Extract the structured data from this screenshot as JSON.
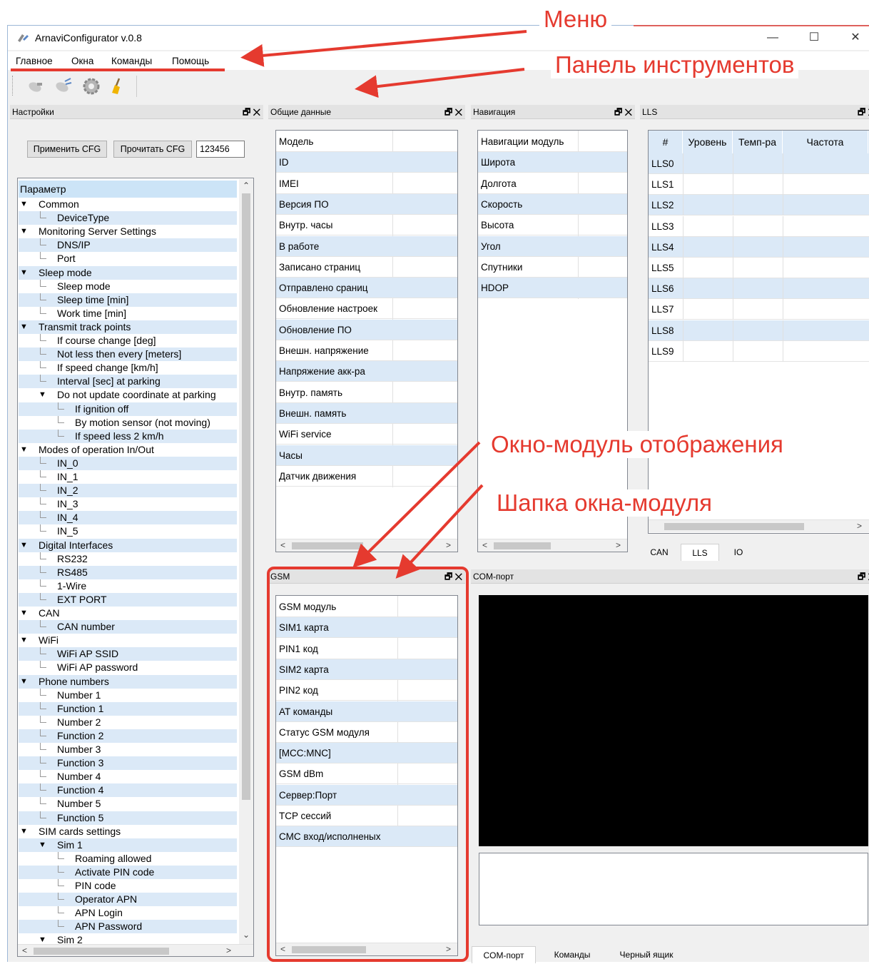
{
  "window": {
    "title": "ArnaviConfigurator v.0.8",
    "minimize": "—",
    "maximize": "☐",
    "close": "✕"
  },
  "menu": [
    "Главное",
    "Окна",
    "Команды",
    "Помощь"
  ],
  "toolbar": {
    "icons": [
      "connect-icon",
      "disconnect-icon",
      "settings-gear-icon",
      "clear-broom-icon"
    ]
  },
  "settings_panel": {
    "title": "Настройки",
    "ctrl": "🗗 ✕",
    "apply_btn": "Применить CFG",
    "read_btn": "Прочитать CFG",
    "password": "123456",
    "tree_header": "Параметр",
    "tree": [
      {
        "l": 0,
        "t": "Common",
        "e": true
      },
      {
        "l": 1,
        "t": "DeviceType"
      },
      {
        "l": 0,
        "t": "Monitoring Server Settings",
        "e": true
      },
      {
        "l": 1,
        "t": "DNS/IP"
      },
      {
        "l": 1,
        "t": "Port"
      },
      {
        "l": 0,
        "t": "Sleep mode",
        "e": true
      },
      {
        "l": 1,
        "t": "Sleep mode"
      },
      {
        "l": 1,
        "t": "Sleep time [min]"
      },
      {
        "l": 1,
        "t": "Work time [min]"
      },
      {
        "l": 0,
        "t": "Transmit track points",
        "e": true
      },
      {
        "l": 1,
        "t": "If course change [deg]"
      },
      {
        "l": 1,
        "t": "Not less then every [meters]"
      },
      {
        "l": 1,
        "t": "If speed change [km/h]"
      },
      {
        "l": 1,
        "t": "Interval [sec] at parking"
      },
      {
        "l": 1,
        "t": "Do not update coordinate at parking",
        "e": true
      },
      {
        "l": 2,
        "t": "If ignition off"
      },
      {
        "l": 2,
        "t": "By motion sensor (not moving)"
      },
      {
        "l": 2,
        "t": "If speed less 2 km/h"
      },
      {
        "l": 0,
        "t": "Modes of operation In/Out",
        "e": true
      },
      {
        "l": 1,
        "t": "IN_0"
      },
      {
        "l": 1,
        "t": "IN_1"
      },
      {
        "l": 1,
        "t": "IN_2"
      },
      {
        "l": 1,
        "t": "IN_3"
      },
      {
        "l": 1,
        "t": "IN_4"
      },
      {
        "l": 1,
        "t": "IN_5"
      },
      {
        "l": 0,
        "t": "Digital Interfaces",
        "e": true
      },
      {
        "l": 1,
        "t": "RS232"
      },
      {
        "l": 1,
        "t": "RS485"
      },
      {
        "l": 1,
        "t": "1-Wire"
      },
      {
        "l": 1,
        "t": "EXT PORT"
      },
      {
        "l": 0,
        "t": "CAN",
        "e": true
      },
      {
        "l": 1,
        "t": "CAN number"
      },
      {
        "l": 0,
        "t": "WiFi",
        "e": true
      },
      {
        "l": 1,
        "t": "WiFi AP SSID"
      },
      {
        "l": 1,
        "t": "WiFi AP password"
      },
      {
        "l": 0,
        "t": "Phone numbers",
        "e": true
      },
      {
        "l": 1,
        "t": "Number 1"
      },
      {
        "l": 1,
        "t": "Function 1"
      },
      {
        "l": 1,
        "t": "Number 2"
      },
      {
        "l": 1,
        "t": "Function 2"
      },
      {
        "l": 1,
        "t": "Number 3"
      },
      {
        "l": 1,
        "t": "Function 3"
      },
      {
        "l": 1,
        "t": "Number 4"
      },
      {
        "l": 1,
        "t": "Function 4"
      },
      {
        "l": 1,
        "t": "Number 5"
      },
      {
        "l": 1,
        "t": "Function 5"
      },
      {
        "l": 0,
        "t": "SIM cards settings",
        "e": true
      },
      {
        "l": 1,
        "t": "Sim 1",
        "e": true
      },
      {
        "l": 2,
        "t": "Roaming allowed"
      },
      {
        "l": 2,
        "t": "Activate PIN code"
      },
      {
        "l": 2,
        "t": "PIN code"
      },
      {
        "l": 2,
        "t": "Operator APN"
      },
      {
        "l": 2,
        "t": "APN Login"
      },
      {
        "l": 2,
        "t": "APN Password"
      },
      {
        "l": 1,
        "t": "Sim 2",
        "e": true
      }
    ]
  },
  "general_panel": {
    "title": "Общие данные",
    "ctrl": "🗗 ✕",
    "rows": [
      "Модель",
      "ID",
      "IMEI",
      "Версия ПО",
      "Внутр. часы",
      "В работе",
      "Записано страниц",
      "Отправлено сраниц",
      "Обновление настроек",
      "Обновление ПО",
      "Внешн. напряжение",
      "Напряжение акк-ра",
      "Внутр. память",
      "Внешн. память",
      "WiFi service",
      "Часы",
      "Датчик движения"
    ]
  },
  "nav_panel": {
    "title": "Навигация",
    "ctrl": "🗗 ✕",
    "rows": [
      "Навигации модуль",
      "Широта",
      "Долгота",
      "Скорость",
      "Высота",
      "Угол",
      "Спутники",
      "HDOP"
    ]
  },
  "lls_panel": {
    "title": "LLS",
    "ctrl": "🗗 ✕",
    "headers": [
      "#",
      "Уровень",
      "Темп-ра",
      "Частота"
    ],
    "rows": [
      "LLS0",
      "LLS1",
      "LLS2",
      "LLS3",
      "LLS4",
      "LLS5",
      "LLS6",
      "LLS7",
      "LLS8",
      "LLS9"
    ],
    "tabs": [
      "CAN",
      "LLS",
      "IO"
    ]
  },
  "gsm_panel": {
    "title": "GSM",
    "ctrl": "🗗 ✕",
    "rows": [
      "GSM модуль",
      "SIM1 карта",
      "PIN1 код",
      "SIM2 карта",
      "PIN2 код",
      "AT команды",
      "Статус GSM модуля",
      "[MCC:MNC]",
      "GSM dBm",
      "Сервер:Порт",
      "TCP сессий",
      "СМС вход/исполненых"
    ]
  },
  "com_panel": {
    "title": "COM-порт",
    "ctrl": "🗗 ✕",
    "tabs": [
      "COM-порт",
      "Команды",
      "Черный ящик"
    ]
  },
  "annotations": {
    "menu": "Меню",
    "toolbar": "Панель инструментов",
    "module": "Окно-модуль отображения",
    "header": "Шапка окна-модуля"
  },
  "colors": {
    "annotation": "#e53a2f",
    "selection": "#cce4f7",
    "alt_row": "#dbe9f7"
  }
}
